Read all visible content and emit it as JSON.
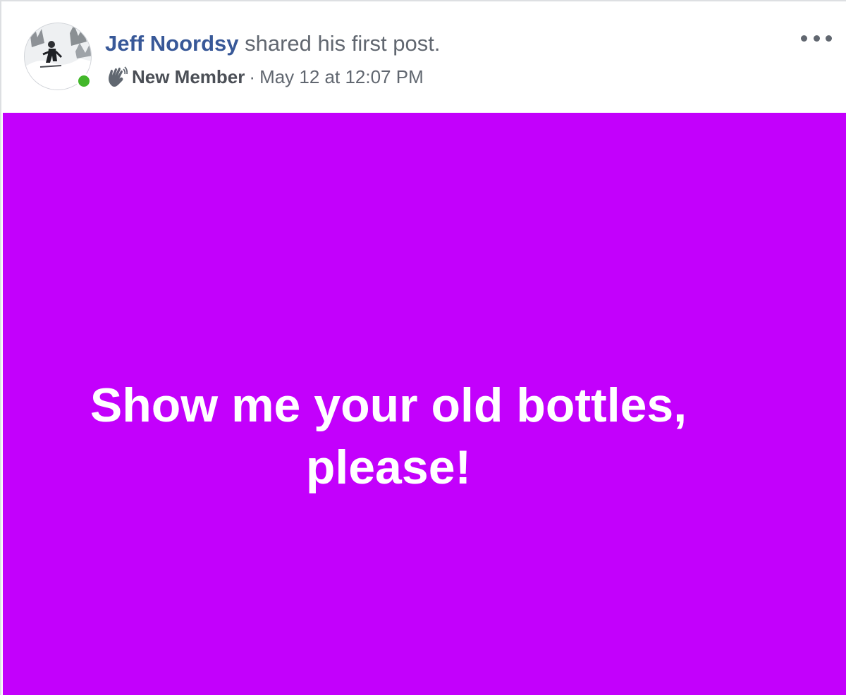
{
  "post": {
    "author_name": "Jeff Noordsy",
    "action_text": " shared his first post.",
    "badge_icon": "waving-hand-icon",
    "badge_label": "New Member",
    "separator": "·",
    "timestamp": "May 12 at 12:07 PM",
    "online_status_color": "#42b72a",
    "menu_icon": "more-options-icon",
    "body_text": "Show me your old bottles, please!",
    "body_background": "#c300fc",
    "body_text_color": "#ffffff",
    "author_color": "#385898"
  }
}
